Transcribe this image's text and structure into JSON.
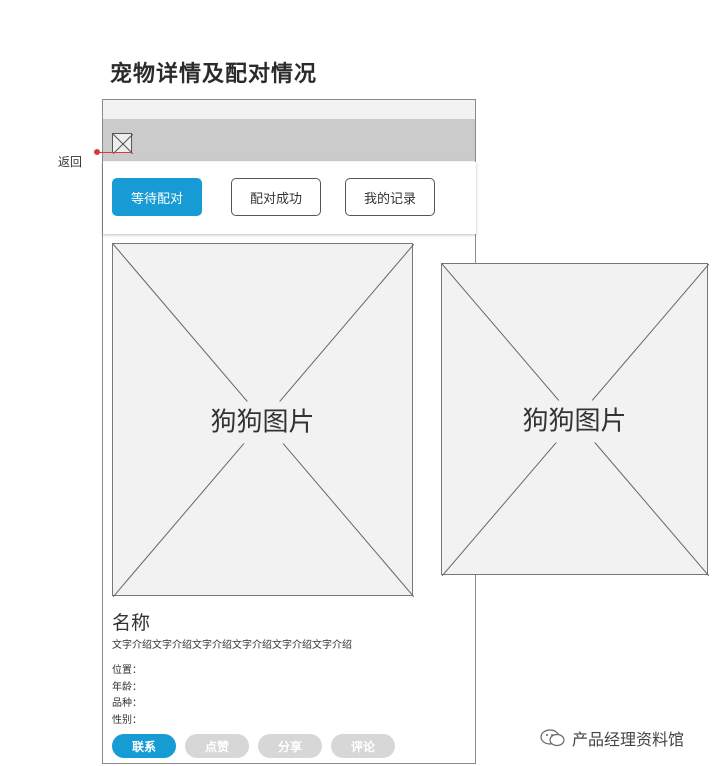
{
  "page_title": "宠物详情及配对情况",
  "annotation": {
    "back_label": "返回"
  },
  "tabs": [
    {
      "label": "等待配对",
      "active": true
    },
    {
      "label": "配对成功",
      "active": false
    },
    {
      "label": "我的记录",
      "active": false
    }
  ],
  "images": {
    "main_label": "狗狗图片",
    "side_label": "狗狗图片"
  },
  "pet": {
    "name": "名称",
    "intro": "文字介绍文字介绍文字介绍文字介绍文字介绍文字介绍",
    "fields": [
      "位置：",
      "年龄：",
      "品种：",
      "性别："
    ]
  },
  "actions": [
    {
      "label": "联系",
      "enabled": true
    },
    {
      "label": "点赞",
      "enabled": false
    },
    {
      "label": "分享",
      "enabled": false
    },
    {
      "label": "评论",
      "enabled": false
    }
  ],
  "watermark": "产品经理资料馆",
  "colors": {
    "accent": "#169bd5",
    "disabled": "#d7d7d7",
    "annotation": "#d83b3b"
  }
}
